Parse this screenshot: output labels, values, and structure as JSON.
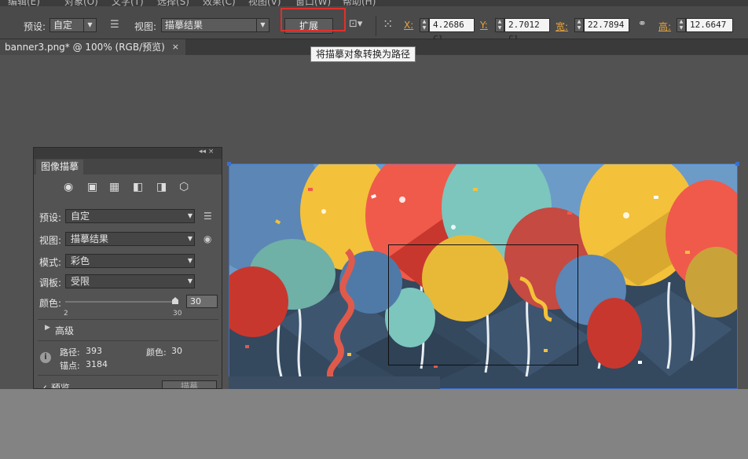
{
  "menubar": {
    "items": [
      "编辑(E)",
      "对象(O)",
      "文字(T)",
      "选择(S)",
      "效果(C)",
      "视图(V)",
      "窗口(W)",
      "帮助(H)"
    ]
  },
  "controlbar": {
    "preset_label": "预设:",
    "preset_value": "自定",
    "view_label": "视图:",
    "view_value": "描摹结果",
    "expand_button": "扩展",
    "x_label": "X:",
    "x_value": "4.2686 cı",
    "y_label": "Y:",
    "y_value": "2.7012 cı",
    "w_label": "宽:",
    "w_value": "22.7894",
    "h_label": "高:",
    "h_value": "12.6647"
  },
  "tooltip": "将描摹对象转换为路径",
  "document_tab": {
    "title": "banner3.png* @ 100% (RGB/预览)",
    "close": "×"
  },
  "panel": {
    "header_icons": "◂◂  ×",
    "tab": "图像描摹",
    "preset_label": "预设:",
    "preset_value": "自定",
    "view_label": "视图:",
    "view_value": "描摹结果",
    "mode_label": "模式:",
    "mode_value": "彩色",
    "palette_label": "调板:",
    "palette_value": "受限",
    "colors_label": "颜色:",
    "colors_value": "30",
    "slider_min": "2",
    "slider_max": "30",
    "slider_level": 1.0,
    "advanced": "高级",
    "paths_label": "路径:",
    "paths_value": "393",
    "colors_stat_label": "颜色:",
    "colors_stat_value": "30",
    "anchors_label": "锚点:",
    "anchors_value": "3184",
    "preview_label": "预览",
    "trace_button": "描摹"
  },
  "colors": {
    "highlight_box": "#e0302a",
    "selection": "#3a6fd1",
    "balloon_red": "#f05a4b",
    "balloon_yellow": "#f3c13a",
    "balloon_teal": "#7cc6bd",
    "sky_blue": "#6d9bc8",
    "dark_navy": "#34485e"
  }
}
